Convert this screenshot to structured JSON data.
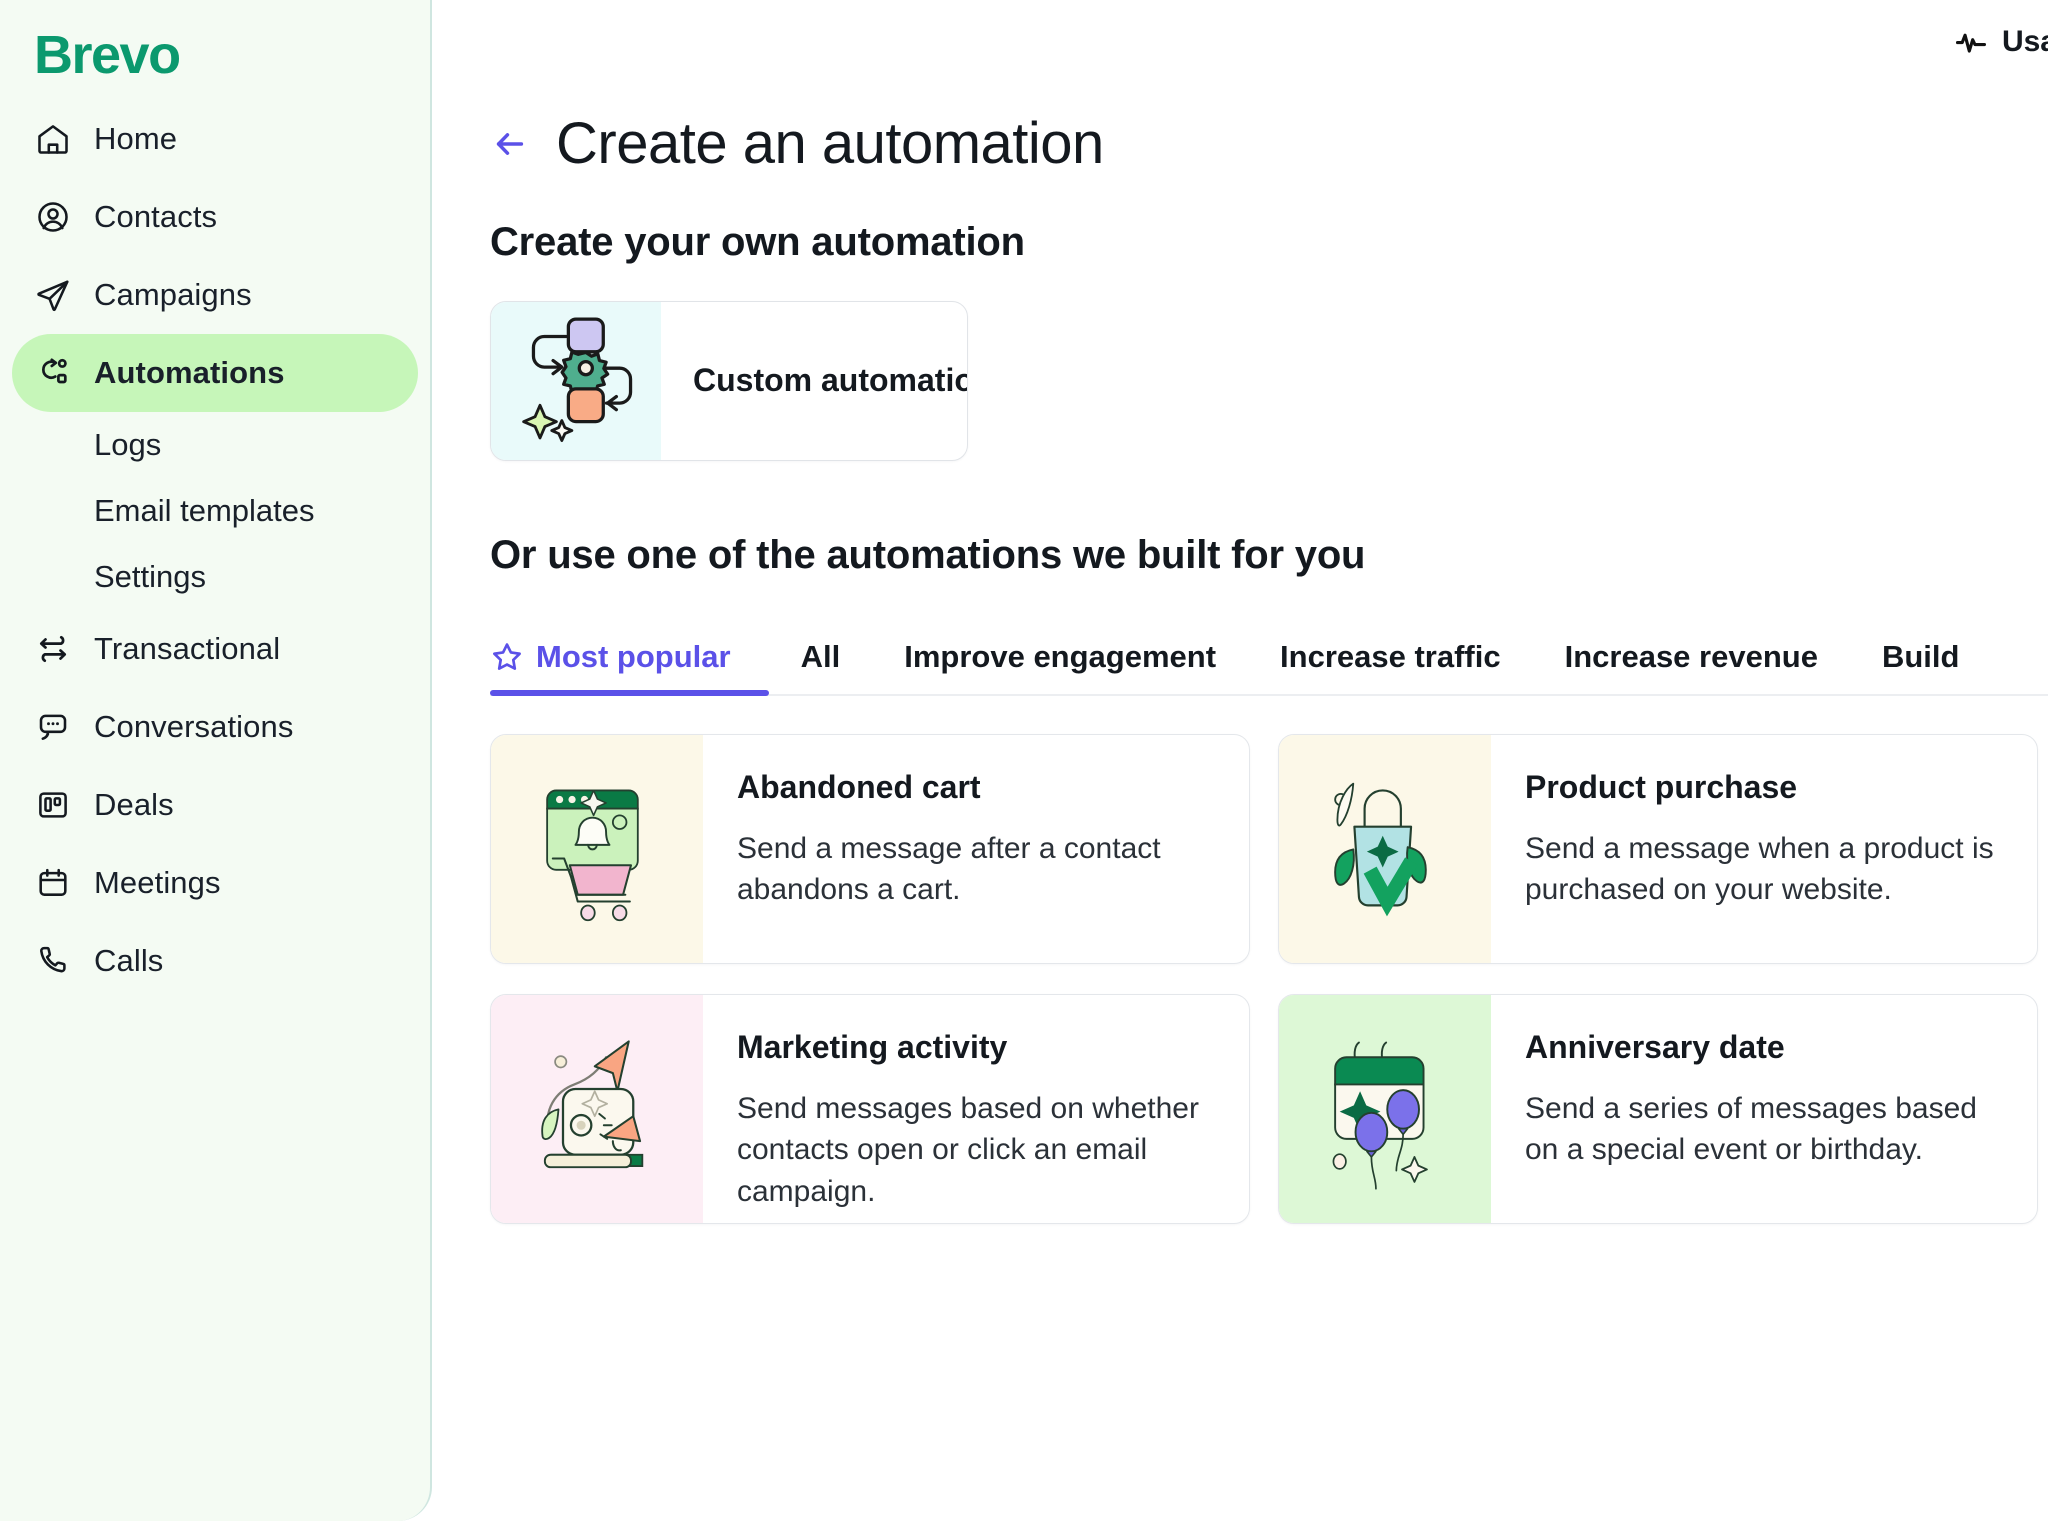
{
  "brand": {
    "name": "Brevo"
  },
  "topbar": {
    "usage_label": "Usage",
    "usage_icon": "activity-pulse-icon"
  },
  "sidebar": {
    "items": [
      {
        "label": "Home",
        "icon": "home-icon",
        "active": false
      },
      {
        "label": "Contacts",
        "icon": "user-circle-icon",
        "active": false
      },
      {
        "label": "Campaigns",
        "icon": "paper-plane-icon",
        "active": false
      },
      {
        "label": "Automations",
        "icon": "automation-flow-icon",
        "active": true
      },
      {
        "label": "Transactional",
        "icon": "exchange-arrows-icon",
        "active": false
      },
      {
        "label": "Conversations",
        "icon": "chat-bubble-icon",
        "active": false
      },
      {
        "label": "Deals",
        "icon": "board-columns-icon",
        "active": false
      },
      {
        "label": "Meetings",
        "icon": "calendar-icon",
        "active": false
      },
      {
        "label": "Calls",
        "icon": "phone-icon",
        "active": false
      }
    ],
    "sub_items": [
      {
        "label": "Logs"
      },
      {
        "label": "Email templates"
      },
      {
        "label": "Settings"
      }
    ]
  },
  "page": {
    "back_icon": "arrow-left-icon",
    "title": "Create an automation",
    "section_own_title": "Create your own automation",
    "section_builtin_title": "Or use one of the automations we built for you"
  },
  "custom_automation": {
    "title": "Custom automation",
    "icon": "custom-automation-illustration",
    "thumb_bg": "#e9fafa"
  },
  "tabs": [
    {
      "label": "Most popular",
      "icon": "star-icon",
      "active": true
    },
    {
      "label": "All",
      "icon": "",
      "active": false
    },
    {
      "label": "Improve engagement",
      "icon": "",
      "active": false
    },
    {
      "label": "Increase traffic",
      "icon": "",
      "active": false
    },
    {
      "label": "Increase revenue",
      "icon": "",
      "active": false
    },
    {
      "label": "Build",
      "icon": "",
      "active": false
    }
  ],
  "automation_cards": [
    {
      "name": "Abandoned cart",
      "description": "Send a message after a contact abandons a cart.",
      "icon": "abandoned-cart-illustration",
      "thumb_bg": "#fcf8e8"
    },
    {
      "name": "Product purchase",
      "description": "Send a message when a product is purchased on your website.",
      "icon": "product-purchase-illustration",
      "thumb_bg": "#fcf8e8"
    },
    {
      "name": "",
      "description": "",
      "icon": "partial-card-illustration",
      "thumb_bg": "#fcf8e8"
    },
    {
      "name": "Marketing activity",
      "description": "Send messages based on whether contacts open or click an email campaign.",
      "icon": "marketing-activity-illustration",
      "thumb_bg": "#fdeef5"
    },
    {
      "name": "Anniversary date",
      "description": "Send a series of messages based on a special event or birthday.",
      "icon": "anniversary-date-illustration",
      "thumb_bg": "#ddf8d6"
    },
    {
      "name": "",
      "description": "",
      "icon": "partial-card-illustration",
      "thumb_bg": "#ffffff"
    }
  ],
  "colors": {
    "brand_green": "#0b996e",
    "accent_purple": "#5b51e8",
    "sidebar_bg": "#f4fbf3",
    "active_nav_bg": "#c6f6b9",
    "active_nav_indicator": "#0b8f63"
  }
}
